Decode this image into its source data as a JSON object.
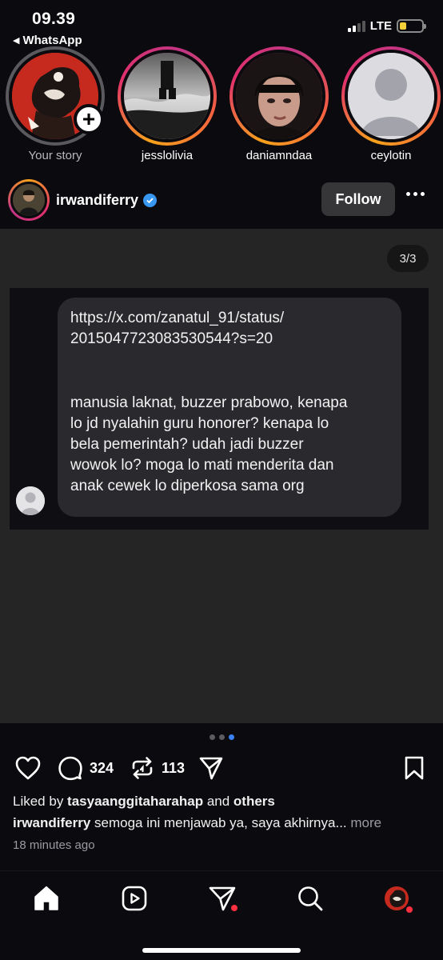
{
  "status_bar": {
    "time": "09.39",
    "back_app": "WhatsApp",
    "network": "LTE",
    "signal_bars": 2,
    "battery_level": 0.25,
    "battery_color": "#f4d13a"
  },
  "stories": [
    {
      "name": "Your story",
      "seen": true,
      "add_badge": "+"
    },
    {
      "name": "jesslolivia",
      "seen": false
    },
    {
      "name": "daniamndaa",
      "seen": false
    },
    {
      "name": "ceylotin",
      "seen": false
    }
  ],
  "post": {
    "username": "irwandiferry",
    "verified": true,
    "follow_label": "Follow",
    "slide_counter": "3/3",
    "active_slide": 3,
    "slide_count": 3,
    "message_lines": [
      "https://x.com/zanatul_91/status/",
      "2015047723083530544?s=20",
      "manusia laknat, buzzer prabowo, kenapa",
      "lo jd nyalahin guru honorer? kenapa lo",
      "bela pemerintah? udah jadi buzzer",
      "wowok lo? moga lo mati menderita dan",
      "anak cewek lo diperkosa sama org"
    ],
    "comment_count": "324",
    "repost_count": "113",
    "liked_by_prefix": "Liked by ",
    "liked_by_user": "tasyaanggitaharahap",
    "liked_by_and": " and ",
    "liked_by_others": "others",
    "caption_user": "irwandiferry",
    "caption_text": " semoga ini menjawab ya, saya akhirnya...",
    "caption_more": " more",
    "timestamp": "18 minutes ago"
  },
  "colors": {
    "background": "#0b0b0f",
    "media_background": "#252525",
    "bubble": "#2a2a2e",
    "accent_blue": "#3b82f6",
    "notification_red": "#ff3040"
  },
  "icons": {
    "actions": [
      "heart-icon",
      "comment-icon",
      "repost-icon",
      "share-icon",
      "bookmark-icon"
    ],
    "nav": [
      "home-icon",
      "reels-icon",
      "messages-icon",
      "search-icon",
      "profile-avatar"
    ]
  }
}
